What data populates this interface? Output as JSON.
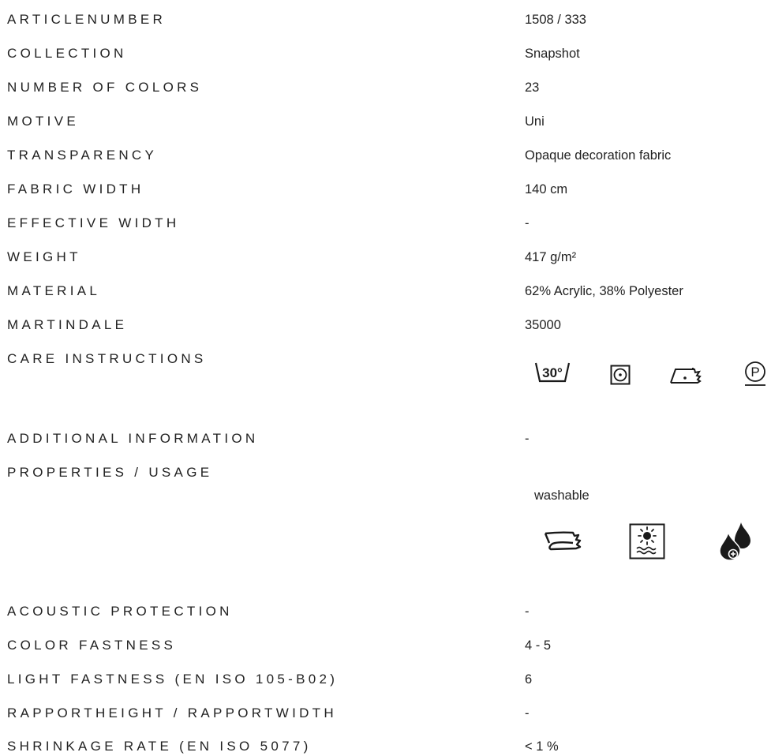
{
  "rows": [
    {
      "label": "ARTICLENUMBER",
      "value": "1508 / 333"
    },
    {
      "label": "COLLECTION",
      "value": "Snapshot"
    },
    {
      "label": "NUMBER OF COLORS",
      "value": "23"
    },
    {
      "label": "MOTIVE",
      "value": "Uni"
    },
    {
      "label": "TRANSPARENCY",
      "value": "Opaque decoration fabric"
    },
    {
      "label": "FABRIC WIDTH",
      "value": "140 cm"
    },
    {
      "label": "EFFECTIVE WIDTH",
      "value": "-"
    },
    {
      "label": "WEIGHT",
      "value": "417 g/m²"
    },
    {
      "label": "MATERIAL",
      "value": "62% Acrylic, 38% Polyester"
    },
    {
      "label": "MARTINDALE",
      "value": "35000"
    }
  ],
  "care_instructions": {
    "label": "CARE INSTRUCTIONS",
    "wash_temp": "30°",
    "dry_clean_letter": "P",
    "icons": [
      "wash-30-icon",
      "tumble-dry-icon",
      "iron-low-icon",
      "dry-clean-p-icon"
    ]
  },
  "additional_information": {
    "label": "ADDITIONAL INFORMATION",
    "value": "-"
  },
  "properties_usage": {
    "label": "PROPERTIES / USAGE",
    "value": "washable",
    "icons": [
      "easy-care-fabric-icon",
      "sun-resistant-icon",
      "water-repellent-icon"
    ]
  },
  "rows_bottom": [
    {
      "label": "ACOUSTIC PROTECTION",
      "value": "-"
    },
    {
      "label": "COLOR FASTNESS",
      "value": "4 - 5"
    },
    {
      "label": "LIGHT FASTNESS (EN ISO 105-B02)",
      "value": "6"
    },
    {
      "label": "RAPPORTHEIGHT / RAPPORTWIDTH",
      "value": "-"
    },
    {
      "label": "SHRINKAGE RATE (EN ISO 5077)",
      "value": "< 1 %"
    }
  ],
  "colors": {
    "text": "#222222",
    "icon": "#1a1a1a",
    "background": "#ffffff"
  }
}
